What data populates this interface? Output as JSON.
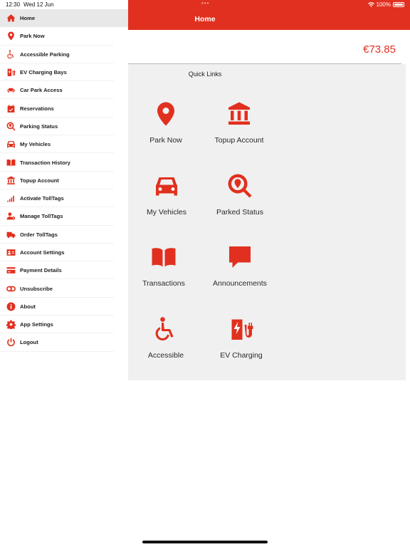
{
  "status_bar": {
    "time": "12:30",
    "date": "Wed 12 Jun",
    "dots": "•••",
    "battery": "100%"
  },
  "header": {
    "title": "Home"
  },
  "balance": "€73.85",
  "sidebar": {
    "items": [
      {
        "label": "Home",
        "icon": "home-icon",
        "active": true
      },
      {
        "label": "Park Now",
        "icon": "map-pin-icon"
      },
      {
        "label": "Accessible Parking",
        "icon": "wheelchair-icon"
      },
      {
        "label": "EV Charging Bays",
        "icon": "ev-charger-icon"
      },
      {
        "label": "Car Park Access",
        "icon": "car-side-icon"
      },
      {
        "label": "Reservations",
        "icon": "calendar-check-icon"
      },
      {
        "label": "Parking Status",
        "icon": "search-location-icon"
      },
      {
        "label": "My Vehicles",
        "icon": "car-icon"
      },
      {
        "label": "Transaction History",
        "icon": "book-icon"
      },
      {
        "label": "Topup Account",
        "icon": "bank-icon"
      },
      {
        "label": "Activate TollTags",
        "icon": "signal-icon"
      },
      {
        "label": "Manage TollTags",
        "icon": "user-settings-icon"
      },
      {
        "label": "Order TollTags",
        "icon": "truck-icon"
      },
      {
        "label": "Account Settings",
        "icon": "id-card-icon"
      },
      {
        "label": "Payment Details",
        "icon": "credit-card-icon"
      },
      {
        "label": "Unsubscribe",
        "icon": "toggle-off-icon"
      },
      {
        "label": "About",
        "icon": "info-icon"
      },
      {
        "label": "App Settings",
        "icon": "gear-icon"
      },
      {
        "label": "Logout",
        "icon": "power-icon"
      }
    ]
  },
  "quick_links": {
    "title": "Quick Links",
    "tiles": [
      {
        "label": "Park Now",
        "icon": "map-pin-icon"
      },
      {
        "label": "Topup Account",
        "icon": "bank-icon"
      },
      {
        "label": "My Vehicles",
        "icon": "car-icon"
      },
      {
        "label": "Parked Status",
        "icon": "search-location-icon"
      },
      {
        "label": "Transactions",
        "icon": "book-icon"
      },
      {
        "label": "Announcements",
        "icon": "speech-bubble-icon"
      },
      {
        "label": "Accessible",
        "icon": "wheelchair-icon"
      },
      {
        "label": "EV Charging",
        "icon": "ev-charger-icon"
      }
    ]
  },
  "colors": {
    "accent": "#e1301f",
    "panel": "#f0f0f0",
    "active_row": "#e8e8e8"
  }
}
